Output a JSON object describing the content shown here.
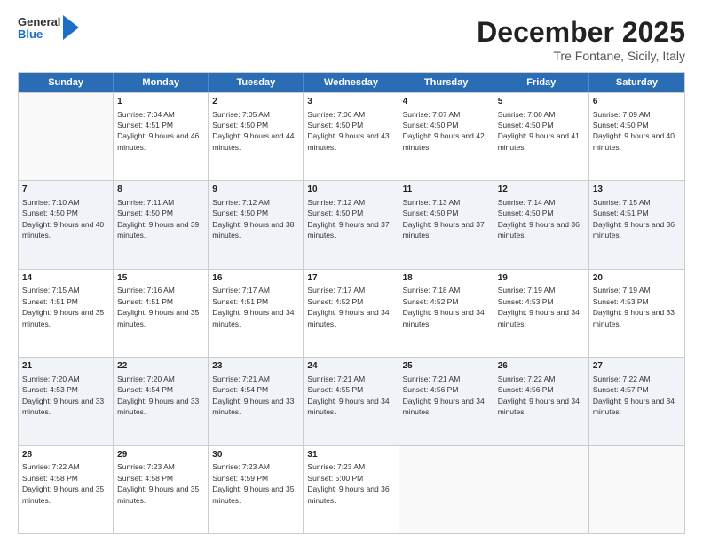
{
  "header": {
    "logo": {
      "line1": "General",
      "line2": "Blue"
    },
    "title": "December 2025",
    "subtitle": "Tre Fontane, Sicily, Italy"
  },
  "days": [
    "Sunday",
    "Monday",
    "Tuesday",
    "Wednesday",
    "Thursday",
    "Friday",
    "Saturday"
  ],
  "weeks": [
    [
      {
        "day": "",
        "empty": true
      },
      {
        "day": "1",
        "sunrise": "7:04 AM",
        "sunset": "4:51 PM",
        "daylight": "9 hours and 46 minutes."
      },
      {
        "day": "2",
        "sunrise": "7:05 AM",
        "sunset": "4:50 PM",
        "daylight": "9 hours and 44 minutes."
      },
      {
        "day": "3",
        "sunrise": "7:06 AM",
        "sunset": "4:50 PM",
        "daylight": "9 hours and 43 minutes."
      },
      {
        "day": "4",
        "sunrise": "7:07 AM",
        "sunset": "4:50 PM",
        "daylight": "9 hours and 42 minutes."
      },
      {
        "day": "5",
        "sunrise": "7:08 AM",
        "sunset": "4:50 PM",
        "daylight": "9 hours and 41 minutes."
      },
      {
        "day": "6",
        "sunrise": "7:09 AM",
        "sunset": "4:50 PM",
        "daylight": "9 hours and 40 minutes."
      }
    ],
    [
      {
        "day": "7",
        "sunrise": "7:10 AM",
        "sunset": "4:50 PM",
        "daylight": "9 hours and 40 minutes."
      },
      {
        "day": "8",
        "sunrise": "7:11 AM",
        "sunset": "4:50 PM",
        "daylight": "9 hours and 39 minutes."
      },
      {
        "day": "9",
        "sunrise": "7:12 AM",
        "sunset": "4:50 PM",
        "daylight": "9 hours and 38 minutes."
      },
      {
        "day": "10",
        "sunrise": "7:12 AM",
        "sunset": "4:50 PM",
        "daylight": "9 hours and 37 minutes."
      },
      {
        "day": "11",
        "sunrise": "7:13 AM",
        "sunset": "4:50 PM",
        "daylight": "9 hours and 37 minutes."
      },
      {
        "day": "12",
        "sunrise": "7:14 AM",
        "sunset": "4:50 PM",
        "daylight": "9 hours and 36 minutes."
      },
      {
        "day": "13",
        "sunrise": "7:15 AM",
        "sunset": "4:51 PM",
        "daylight": "9 hours and 36 minutes."
      }
    ],
    [
      {
        "day": "14",
        "sunrise": "7:15 AM",
        "sunset": "4:51 PM",
        "daylight": "9 hours and 35 minutes."
      },
      {
        "day": "15",
        "sunrise": "7:16 AM",
        "sunset": "4:51 PM",
        "daylight": "9 hours and 35 minutes."
      },
      {
        "day": "16",
        "sunrise": "7:17 AM",
        "sunset": "4:51 PM",
        "daylight": "9 hours and 34 minutes."
      },
      {
        "day": "17",
        "sunrise": "7:17 AM",
        "sunset": "4:52 PM",
        "daylight": "9 hours and 34 minutes."
      },
      {
        "day": "18",
        "sunrise": "7:18 AM",
        "sunset": "4:52 PM",
        "daylight": "9 hours and 34 minutes."
      },
      {
        "day": "19",
        "sunrise": "7:19 AM",
        "sunset": "4:53 PM",
        "daylight": "9 hours and 34 minutes."
      },
      {
        "day": "20",
        "sunrise": "7:19 AM",
        "sunset": "4:53 PM",
        "daylight": "9 hours and 33 minutes."
      }
    ],
    [
      {
        "day": "21",
        "sunrise": "7:20 AM",
        "sunset": "4:53 PM",
        "daylight": "9 hours and 33 minutes."
      },
      {
        "day": "22",
        "sunrise": "7:20 AM",
        "sunset": "4:54 PM",
        "daylight": "9 hours and 33 minutes."
      },
      {
        "day": "23",
        "sunrise": "7:21 AM",
        "sunset": "4:54 PM",
        "daylight": "9 hours and 33 minutes."
      },
      {
        "day": "24",
        "sunrise": "7:21 AM",
        "sunset": "4:55 PM",
        "daylight": "9 hours and 34 minutes."
      },
      {
        "day": "25",
        "sunrise": "7:21 AM",
        "sunset": "4:56 PM",
        "daylight": "9 hours and 34 minutes."
      },
      {
        "day": "26",
        "sunrise": "7:22 AM",
        "sunset": "4:56 PM",
        "daylight": "9 hours and 34 minutes."
      },
      {
        "day": "27",
        "sunrise": "7:22 AM",
        "sunset": "4:57 PM",
        "daylight": "9 hours and 34 minutes."
      }
    ],
    [
      {
        "day": "28",
        "sunrise": "7:22 AM",
        "sunset": "4:58 PM",
        "daylight": "9 hours and 35 minutes."
      },
      {
        "day": "29",
        "sunrise": "7:23 AM",
        "sunset": "4:58 PM",
        "daylight": "9 hours and 35 minutes."
      },
      {
        "day": "30",
        "sunrise": "7:23 AM",
        "sunset": "4:59 PM",
        "daylight": "9 hours and 35 minutes."
      },
      {
        "day": "31",
        "sunrise": "7:23 AM",
        "sunset": "5:00 PM",
        "daylight": "9 hours and 36 minutes."
      },
      {
        "day": "",
        "empty": true
      },
      {
        "day": "",
        "empty": true
      },
      {
        "day": "",
        "empty": true
      }
    ]
  ],
  "labels": {
    "sunrise": "Sunrise:",
    "sunset": "Sunset:",
    "daylight": "Daylight:"
  }
}
